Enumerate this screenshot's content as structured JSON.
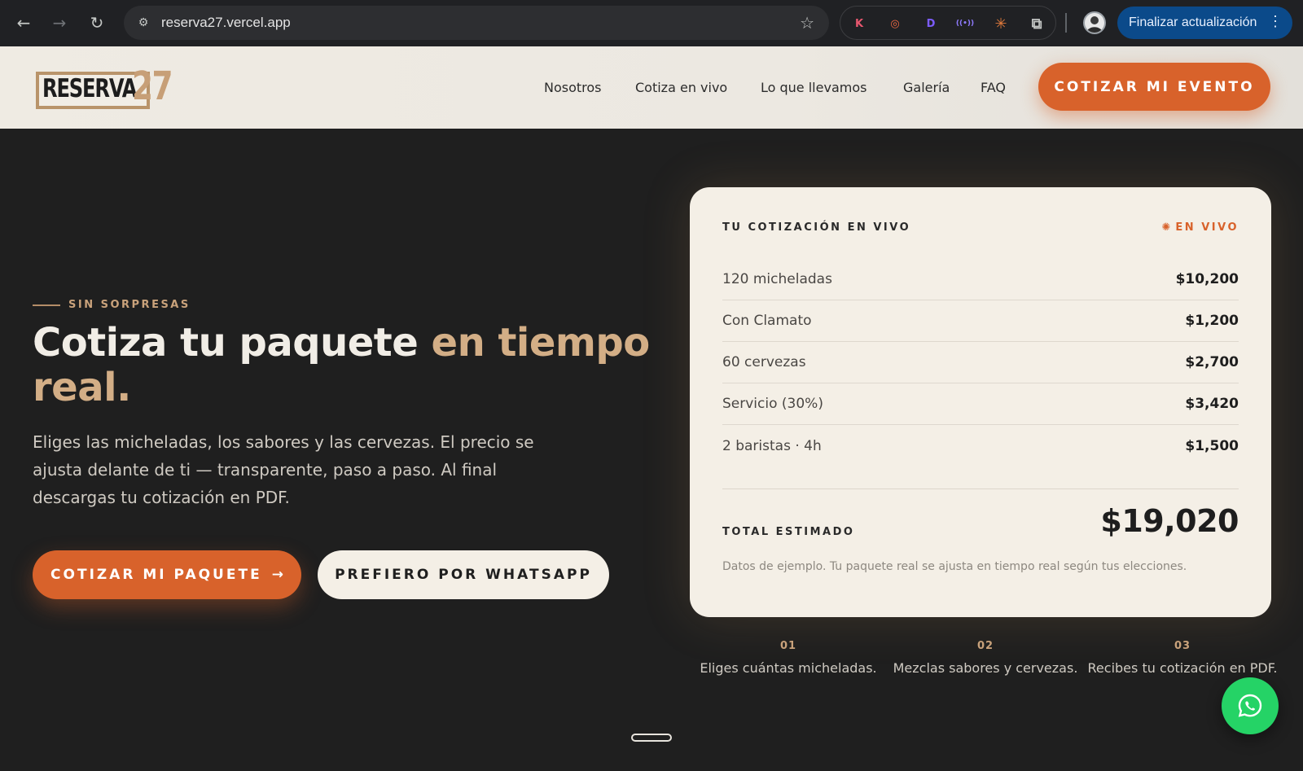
{
  "browser": {
    "url": "reserva27.vercel.app",
    "update_label": "Finalizar actualización",
    "extensions": [
      {
        "name": "k-extension-icon",
        "glyph": "K",
        "color": "#e8576f"
      },
      {
        "name": "instagram-extension-icon",
        "glyph": "◎",
        "color": "#f06a44"
      },
      {
        "name": "d-extension-icon",
        "glyph": "D",
        "color": "#7c5cff"
      },
      {
        "name": "broadcast-extension-icon",
        "glyph": "((•))",
        "color": "#8f7bff"
      },
      {
        "name": "sparkle-extension-icon",
        "glyph": "✳",
        "color": "#e07a3c"
      },
      {
        "name": "puzzle-extension-icon",
        "glyph": "⧉",
        "color": "#c4c7c5"
      }
    ]
  },
  "header": {
    "logo_word": "RESERVA",
    "logo_number": "27",
    "nav": [
      "Nosotros",
      "Cotiza en vivo",
      "Lo que llevamos",
      "Galería",
      "FAQ"
    ],
    "cta": "COTIZAR MI EVENTO"
  },
  "hero": {
    "eyebrow": "SIN SORPRESAS",
    "headline_start": "Cotiza tu paquete ",
    "headline_accent": "en tiempo real.",
    "lead": "Eliges las micheladas, los sabores y las cervezas. El precio se ajusta delante de ti — transparente, paso a paso. Al final descargas tu cotización en PDF.",
    "primary_cta": "COTIZAR MI PAQUETE",
    "secondary_cta": "PREFIERO POR WHATSAPP"
  },
  "quote": {
    "title": "TU COTIZACIÓN EN VIVO",
    "live_label": "EN VIVO",
    "items": [
      {
        "label": "120 micheladas",
        "value": "$10,200"
      },
      {
        "label": "Con Clamato",
        "value": "$1,200"
      },
      {
        "label": "60 cervezas",
        "value": "$2,700"
      },
      {
        "label": "Servicio (30%)",
        "value": "$3,420"
      },
      {
        "label": "2 baristas · 4h",
        "value": "$1,500"
      }
    ],
    "total_label": "TOTAL ESTIMADO",
    "total_value": "$19,020",
    "note": "Datos de ejemplo. Tu paquete real se ajusta en tiempo real según tus elecciones."
  },
  "steps": [
    {
      "num": "01",
      "text": "Eliges cuántas micheladas."
    },
    {
      "num": "02",
      "text": "Mezclas sabores y cervezas."
    },
    {
      "num": "03",
      "text": "Recibes tu cotización en PDF."
    }
  ],
  "colors": {
    "accent": "#d8622b",
    "gold": "#d3ae86",
    "background": "#1f1f1f",
    "card": "#f4efe6",
    "whatsapp": "#25d366"
  }
}
